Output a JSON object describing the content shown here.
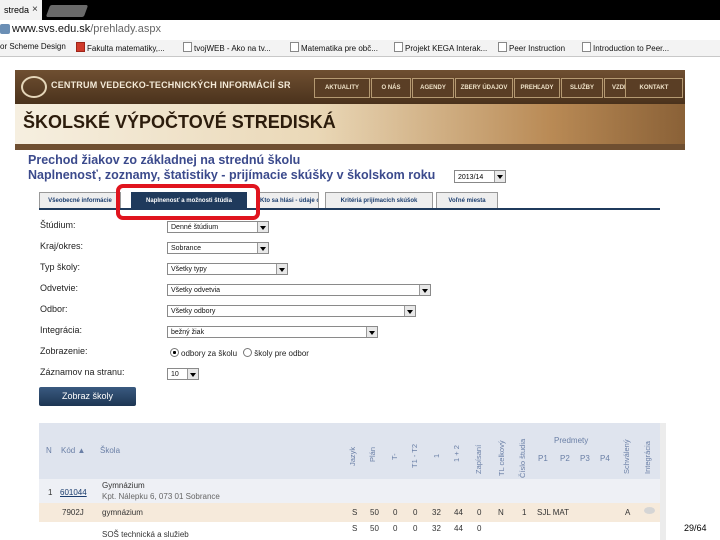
{
  "browser": {
    "tab_title": "streda",
    "tab_close": "×",
    "url_domain": "www.svs.edu.sk",
    "url_path": "/prehlady.aspx",
    "bookmarks": [
      {
        "label": "or Scheme Design"
      },
      {
        "label": "Fakulta matematiky,..."
      },
      {
        "label": "tvojWEB - Ako na tv..."
      },
      {
        "label": "Matematika pre obč..."
      },
      {
        "label": "Projekt KEGA Interak..."
      },
      {
        "label": "Peer Instruction"
      },
      {
        "label": "Introduction to Peer..."
      }
    ]
  },
  "site": {
    "logo_text": "CENTRUM VEDECKO-TECHNICKÝCH INFORMÁCIÍ SR",
    "nav": [
      "AKTUALITY",
      "O NÁS",
      "AGENDY",
      "ZBERY ÚDAJOV",
      "PREHĽADY",
      "SLUŽBY",
      "VZDELÁVANIE",
      "KONTAKT"
    ],
    "banner_title": "ŠKOLSKÉ VÝPOČTOVÉ STREDISKÁ"
  },
  "page": {
    "heading1": "Prechod žiakov zo základnej na strednú školu",
    "heading2": "Naplnenosť, zoznamy, štatistiky - prijímacie skúšky v školskom roku",
    "year": "2013/14",
    "tabs": [
      {
        "label": "Všeobecné informácie",
        "active": false
      },
      {
        "label": "Naplnenosť a možnosti štúdia",
        "active": true
      },
      {
        "label": "Kto sa hlási - údaje o škole",
        "active": false
      },
      {
        "label": "Kritériá prijímacích skúšok",
        "active": false
      },
      {
        "label": "Voľné miesta",
        "active": false
      }
    ]
  },
  "filters": [
    {
      "label": "Štúdium:",
      "value": "Denné štúdium"
    },
    {
      "label": "Kraj/okres:",
      "value": "Sobrance"
    },
    {
      "label": "Typ školy:",
      "value": "Všetky typy"
    },
    {
      "label": "Odvetvie:",
      "value": "Všetky odvetvia"
    },
    {
      "label": "Odbor:",
      "value": "Všetky odbory"
    },
    {
      "label": "Integrácia:",
      "value": "bežný žiak"
    },
    {
      "label": "Zobrazenie:",
      "value": ""
    },
    {
      "label": "Záznamov na stranu:",
      "value": "10"
    }
  ],
  "display": {
    "option1": "odbory za školu",
    "option2": "školy pre odbor"
  },
  "submit_label": "Zobraz školy",
  "table": {
    "headers": {
      "n": "N",
      "kod": "Kód ▲",
      "skola": "Škola",
      "jazyk": "Jazyk",
      "plan": "Plán",
      "t": "T-",
      "t1t2": "T1 - T2",
      "one": "1",
      "ln2": "1 + 2",
      "zapisani": "Zapísaní",
      "tl": "TL celkový",
      "cislo": "Číslo študia",
      "predmety": "Predmety",
      "p1": "P1",
      "p2": "P2",
      "p3": "P3",
      "p4": "P4",
      "schvaleny": "Schválený",
      "integracia": "Integrácia"
    },
    "row1": {
      "n": "1",
      "kod": "601044",
      "skola_line1": "Gymnázium",
      "skola_line2": "Kpt. Nálepku 6, 073 01 Sobrance"
    },
    "row2": {
      "kod": "7902J",
      "skola": "gymnázium",
      "jazyk": "S",
      "plan": "50",
      "t": "0",
      "t1t2": "0",
      "one": "32",
      "ln2": "44",
      "zapisani": "0",
      "tl": "N",
      "cislo": "1",
      "predmety": "SJL MAT",
      "schvaleny": "A"
    },
    "row3": {
      "skola": "SOŠ technická a služieb",
      "jazyk": "S",
      "plan": "50",
      "t": "0",
      "t1t2": "0",
      "one": "32",
      "ln2": "44",
      "zapisani": "0"
    }
  },
  "slide_number": "29/64"
}
